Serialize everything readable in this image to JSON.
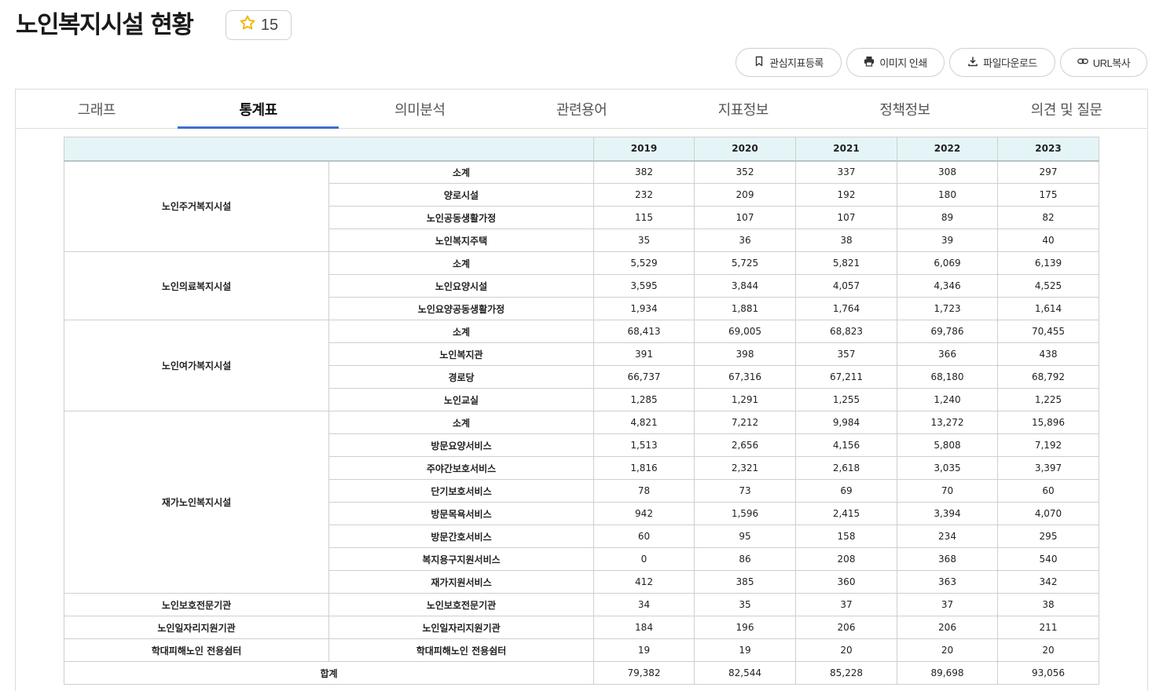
{
  "header": {
    "title": "노인복지시설 현황",
    "favorite_count": "15"
  },
  "actions": {
    "bookmark": "관심지표등록",
    "print": "이미지 인쇄",
    "download": "파일다운로드",
    "copy_url": "URL복사"
  },
  "tabs": [
    "그래프",
    "통계표",
    "의미분석",
    "관련용어",
    "지표정보",
    "정책정보",
    "의견 및 질문"
  ],
  "active_tab": 1,
  "table": {
    "years": [
      "2019",
      "2020",
      "2021",
      "2022",
      "2023"
    ],
    "groups": [
      {
        "name": "노인주거복지시설",
        "rows": [
          {
            "label": "소계",
            "values": [
              "382",
              "352",
              "337",
              "308",
              "297"
            ]
          },
          {
            "label": "양로시설",
            "values": [
              "232",
              "209",
              "192",
              "180",
              "175"
            ]
          },
          {
            "label": "노인공동생활가정",
            "values": [
              "115",
              "107",
              "107",
              "89",
              "82"
            ]
          },
          {
            "label": "노인복지주택",
            "values": [
              "35",
              "36",
              "38",
              "39",
              "40"
            ]
          }
        ]
      },
      {
        "name": "노인의료복지시설",
        "rows": [
          {
            "label": "소계",
            "values": [
              "5,529",
              "5,725",
              "5,821",
              "6,069",
              "6,139"
            ]
          },
          {
            "label": "노인요양시설",
            "values": [
              "3,595",
              "3,844",
              "4,057",
              "4,346",
              "4,525"
            ]
          },
          {
            "label": "노인요양공동생활가정",
            "values": [
              "1,934",
              "1,881",
              "1,764",
              "1,723",
              "1,614"
            ]
          }
        ]
      },
      {
        "name": "노인여가복지시설",
        "rows": [
          {
            "label": "소계",
            "values": [
              "68,413",
              "69,005",
              "68,823",
              "69,786",
              "70,455"
            ]
          },
          {
            "label": "노인복지관",
            "values": [
              "391",
              "398",
              "357",
              "366",
              "438"
            ]
          },
          {
            "label": "경로당",
            "values": [
              "66,737",
              "67,316",
              "67,211",
              "68,180",
              "68,792"
            ]
          },
          {
            "label": "노인교실",
            "values": [
              "1,285",
              "1,291",
              "1,255",
              "1,240",
              "1,225"
            ]
          }
        ]
      },
      {
        "name": "재가노인복지시설",
        "rows": [
          {
            "label": "소계",
            "values": [
              "4,821",
              "7,212",
              "9,984",
              "13,272",
              "15,896"
            ]
          },
          {
            "label": "방문요양서비스",
            "values": [
              "1,513",
              "2,656",
              "4,156",
              "5,808",
              "7,192"
            ]
          },
          {
            "label": "주야간보호서비스",
            "values": [
              "1,816",
              "2,321",
              "2,618",
              "3,035",
              "3,397"
            ]
          },
          {
            "label": "단기보호서비스",
            "values": [
              "78",
              "73",
              "69",
              "70",
              "60"
            ]
          },
          {
            "label": "방문목욕서비스",
            "values": [
              "942",
              "1,596",
              "2,415",
              "3,394",
              "4,070"
            ]
          },
          {
            "label": "방문간호서비스",
            "values": [
              "60",
              "95",
              "158",
              "234",
              "295"
            ]
          },
          {
            "label": "복지용구지원서비스",
            "values": [
              "0",
              "86",
              "208",
              "368",
              "540"
            ]
          },
          {
            "label": "재가지원서비스",
            "values": [
              "412",
              "385",
              "360",
              "363",
              "342"
            ]
          }
        ]
      },
      {
        "name": "노인보호전문기관",
        "rows": [
          {
            "label": "노인보호전문기관",
            "values": [
              "34",
              "35",
              "37",
              "37",
              "38"
            ]
          }
        ]
      },
      {
        "name": "노인일자리지원기관",
        "rows": [
          {
            "label": "노인일자리지원기관",
            "values": [
              "184",
              "196",
              "206",
              "206",
              "211"
            ]
          }
        ]
      },
      {
        "name": "학대피해노인 전용쉼터",
        "rows": [
          {
            "label": "학대피해노인 전용쉼터",
            "values": [
              "19",
              "19",
              "20",
              "20",
              "20"
            ]
          }
        ]
      }
    ],
    "total": {
      "label": "합계",
      "values": [
        "79,382",
        "82,544",
        "85,228",
        "89,698",
        "93,056"
      ]
    }
  },
  "colors": {
    "accent": "#3e6fd1",
    "header_bg": "#e5f5f7",
    "star": "#f2b300"
  }
}
